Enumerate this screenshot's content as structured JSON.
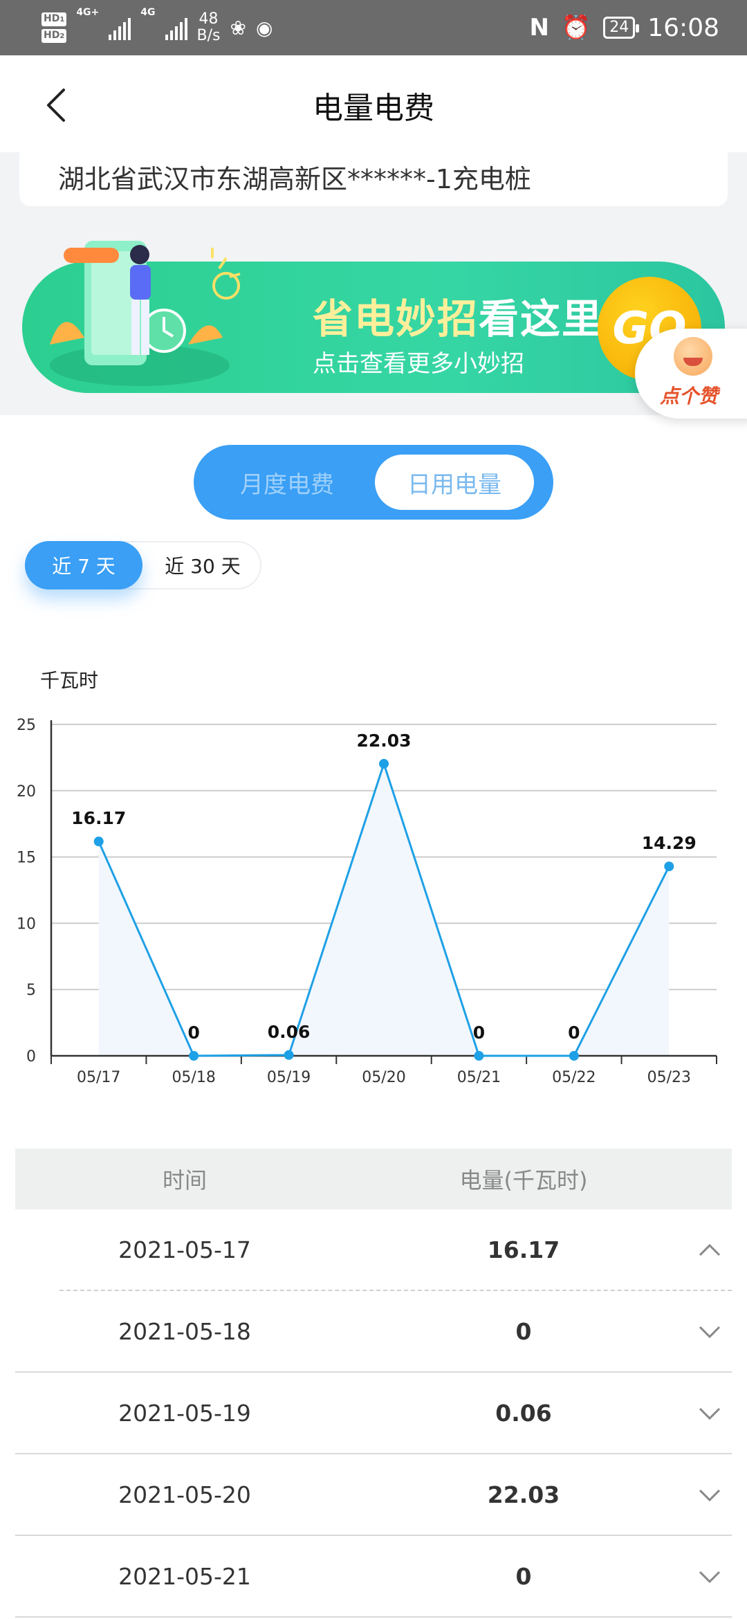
{
  "status_bar": {
    "sim1": "HD",
    "sim1_no": "1",
    "sim2": "HD",
    "sim2_no": "2",
    "network1": "4G+",
    "network2": "4G",
    "net_speed_value": "48",
    "net_speed_unit": "B/s",
    "battery": "24",
    "time": "16:08",
    "icons": [
      "nfc-icon",
      "alarm-icon",
      "battery-icon",
      "app-notification-icon",
      "wechat-icon"
    ]
  },
  "header": {
    "title": "电量电费"
  },
  "address": "湖北省武汉市东湖高新区******-1充电桩",
  "banner": {
    "headline_part1": "省电妙招",
    "headline_part2": "看这里",
    "subtitle": "点击查看更多小妙招",
    "go_label": "GO"
  },
  "like_button": {
    "label": "点个赞"
  },
  "tabs": {
    "monthly": "月度电费",
    "daily": "日用电量",
    "active": "daily"
  },
  "range": {
    "r7": "近 7 天",
    "r30": "近 30 天",
    "active": "r7"
  },
  "chart_data": {
    "type": "line",
    "ylabel": "千瓦时",
    "x": [
      "05/17",
      "05/18",
      "05/19",
      "05/20",
      "05/21",
      "05/22",
      "05/23"
    ],
    "values": [
      16.17,
      0,
      0.06,
      22.03,
      0,
      0,
      14.29
    ],
    "data_labels": [
      "16.17",
      "0",
      "0.06",
      "22.03",
      "0",
      "0",
      "14.29"
    ],
    "y_ticks": [
      "0",
      "5",
      "10",
      "15",
      "20",
      "25"
    ],
    "ylim": [
      0,
      25
    ],
    "grid": true,
    "area_fill": true,
    "colors": {
      "line": "#1ea0e6",
      "fill": "#f2f7fd",
      "grid": "#cccccc"
    }
  },
  "table": {
    "header_time": "时间",
    "header_value": "电量(千瓦时)",
    "rows": [
      {
        "date": "2021-05-17",
        "value": "16.17",
        "expanded": true
      },
      {
        "date": "2021-05-18",
        "value": "0",
        "expanded": false
      },
      {
        "date": "2021-05-19",
        "value": "0.06",
        "expanded": false
      },
      {
        "date": "2021-05-20",
        "value": "22.03",
        "expanded": false
      },
      {
        "date": "2021-05-21",
        "value": "0",
        "expanded": false
      }
    ]
  },
  "colors": {
    "accent": "#3a9ff5",
    "banner_green": "#2ccf90",
    "go_yellow": "#f6a800",
    "status_bar": "#6b6b6b"
  }
}
